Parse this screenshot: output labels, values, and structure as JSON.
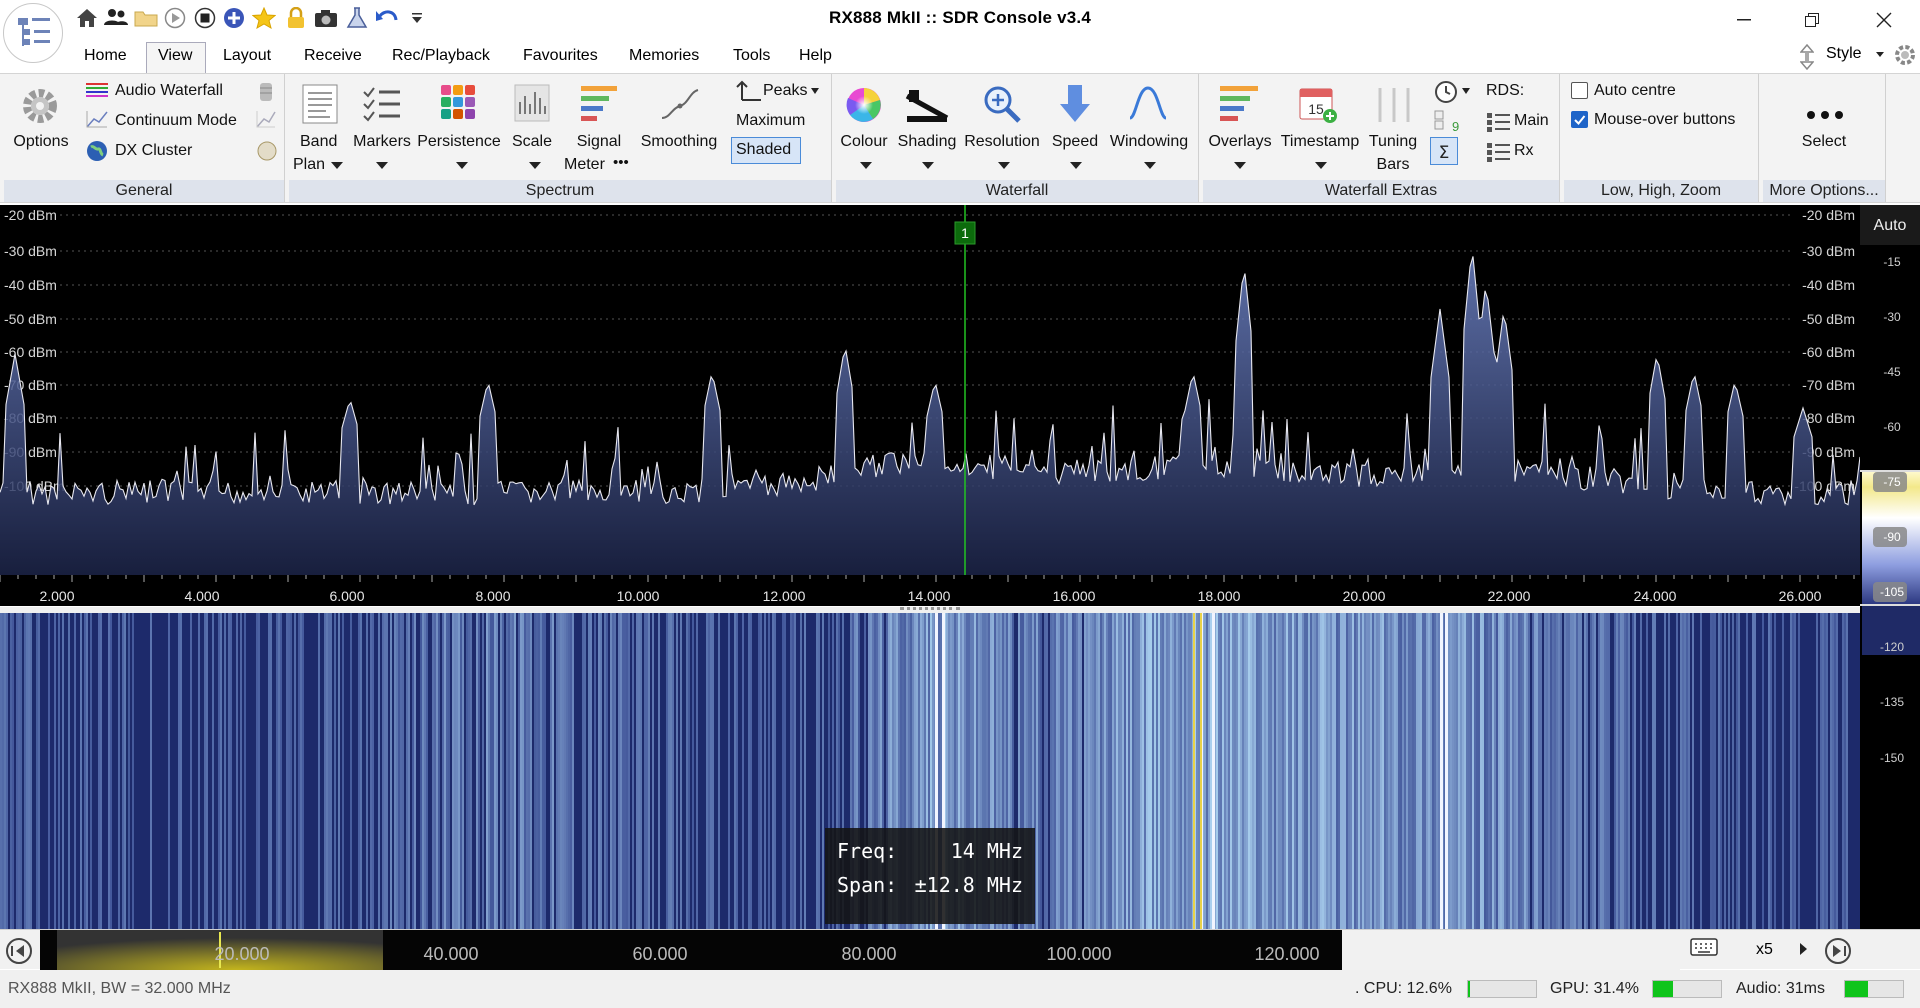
{
  "window": {
    "title": "RX888 MkII :: SDR Console v3.4"
  },
  "menu": {
    "items": [
      "Home",
      "View",
      "Layout",
      "Receive",
      "Rec/Playback",
      "Favourites",
      "Memories",
      "Tools",
      "Help"
    ],
    "style_label": "Style"
  },
  "ribbon": {
    "general": {
      "label": "General",
      "options": "Options",
      "audio_waterfall": "Audio Waterfall",
      "continuum": "Continuum Mode",
      "dx_cluster": "DX Cluster"
    },
    "spectrum": {
      "label": "Spectrum",
      "band_plan_1": "Band",
      "band_plan_2": "Plan",
      "markers": "Markers",
      "persistence": "Persistence",
      "scale": "Scale",
      "signal_meter_1": "Signal",
      "signal_meter_2": "Meter",
      "smoothing": "Smoothing",
      "peaks": "Peaks",
      "maximum": "Maximum",
      "shaded": "Shaded",
      "more": "•••"
    },
    "waterfall": {
      "label": "Waterfall",
      "colour": "Colour",
      "shading": "Shading",
      "resolution": "Resolution",
      "speed": "Speed",
      "windowing": "Windowing"
    },
    "waterfall_extras": {
      "label": "Waterfall Extras",
      "overlays": "Overlays",
      "timestamp": "Timestamp",
      "tuning_bars_1": "Tuning",
      "tuning_bars_2": "Bars",
      "rds": "RDS:",
      "rds_main": "Main",
      "rds_rx": "Rx",
      "calendar_day": "15"
    },
    "zoom": {
      "label": "Low, High, Zoom",
      "auto_centre": "Auto centre",
      "auto_centre_checked": false,
      "mouseover": "Mouse-over buttons",
      "mouseover_checked": true
    },
    "more": {
      "label": "More Options...",
      "select": "Select"
    }
  },
  "spectrum": {
    "db_labels": [
      "-20 dBm",
      "-30 dBm",
      "-40 dBm",
      "-50 dBm",
      "-60 dBm",
      "-70 dBm",
      "-80 dBm",
      "-90 dBm",
      "-100 dBm"
    ],
    "freq_labels": [
      "2.000",
      "4.000",
      "6.000",
      "8.000",
      "10.000",
      "12.000",
      "14.000",
      "16.000",
      "18.000",
      "20.000",
      "22.000",
      "24.000",
      "26.000"
    ],
    "marker": "1",
    "auto_label": "Auto",
    "colour_scale": [
      "-15",
      "-30",
      "-45",
      "-60",
      "-75",
      "-90",
      "-105",
      "-120",
      "-135",
      "-150"
    ]
  },
  "waterfall": {
    "freq_label": "Freq:",
    "freq_value": "14 MHz",
    "span_label": "Span:",
    "span_value": "±12.8 MHz"
  },
  "overview": {
    "labels": [
      "20.000",
      "40.000",
      "60.000",
      "80.000",
      "100.000",
      "120.000"
    ],
    "zoom": "x5"
  },
  "status": {
    "device": "RX888 MkII, BW = 32.000 MHz",
    "cpu": ". CPU: 12.6%",
    "cpu_fill": 0.03,
    "gpu": "GPU: 31.4%",
    "gpu_fill": 0.3,
    "audio": "Audio: 31ms",
    "audio_fill": 0.4
  },
  "colors": {
    "ribbon_group_label": "#dee3ec",
    "accent_blue": "#1e64c8",
    "spectrum_fill": "#4a5f9a",
    "marker_green": "#22c322"
  }
}
